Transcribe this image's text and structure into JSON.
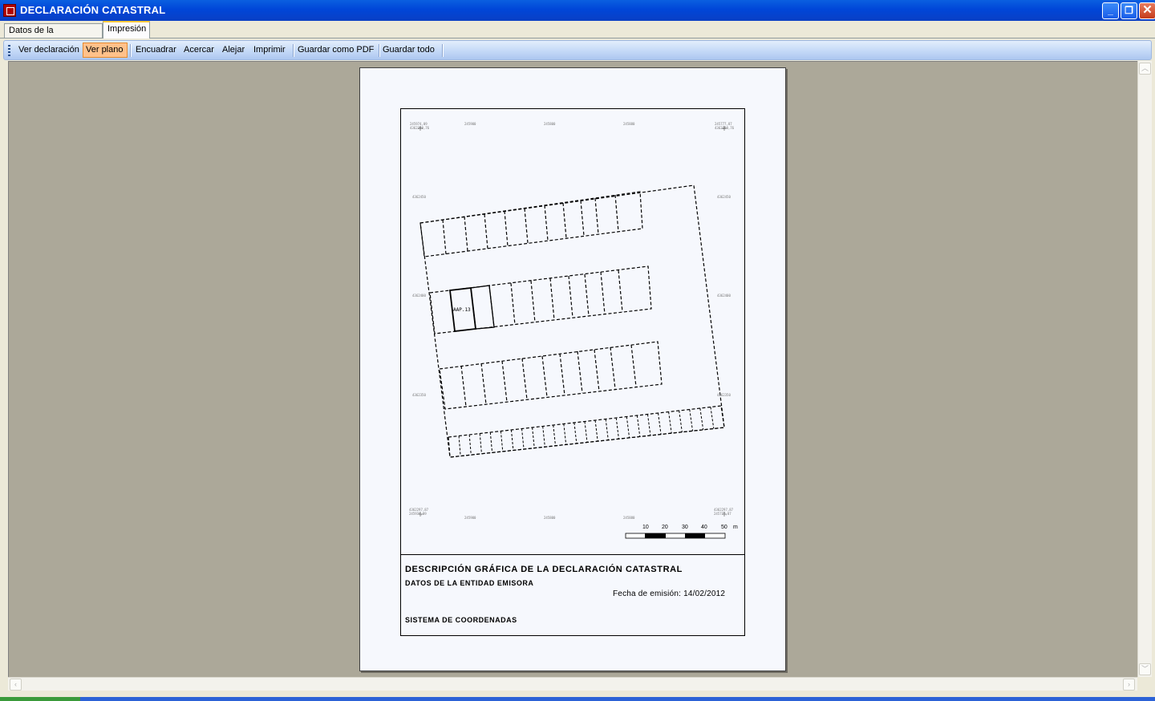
{
  "window": {
    "title": "DECLARACIÓN CATASTRAL",
    "buttons": {
      "minimize": "_",
      "restore": "❐",
      "close": "✕"
    }
  },
  "tabs": [
    {
      "label": "Datos de la declaracion",
      "active": false
    },
    {
      "label": "Impresión",
      "active": true
    }
  ],
  "toolbar": {
    "items": [
      {
        "label": "Ver declaración"
      },
      {
        "label": "Ver plano",
        "active": true
      },
      {
        "label": "Encuadrar"
      },
      {
        "label": "Acercar"
      },
      {
        "label": "Alejar"
      },
      {
        "label": "Imprimir"
      },
      {
        "label": "Guardar como PDF"
      },
      {
        "label": "Guardar todo"
      }
    ]
  },
  "plan": {
    "coords": {
      "top_left": "245974,09\n4362398,76",
      "top_1": "245900",
      "top_2": "245800",
      "top_3": "245880",
      "top_right": "245777,87\n4362398,76",
      "left_1": "4362450",
      "right_1": "4362450",
      "left_2": "4362400",
      "right_2": "4362400",
      "left_3": "4362350",
      "right_3": "4362350",
      "bottom_left": "4362297,87\n245974,09",
      "bottom_1": "245900",
      "bottom_2": "245800",
      "bottom_3": "245880",
      "bottom_right": "4362297,87\n245777,87"
    },
    "parcel_label": "AAP.13",
    "scale": {
      "ticks": [
        "10",
        "20",
        "30",
        "40",
        "50"
      ],
      "unit": "m"
    }
  },
  "legend": {
    "title": "DESCRIPCIÓN GRÁFICA DE LA DECLARACIÓN CATASTRAL",
    "entity": "DATOS DE LA ENTIDAD EMISORA",
    "date": "Fecha de emisión: 14/02/2012",
    "coords": "SISTEMA DE COORDENADAS"
  },
  "colors": {
    "title_bar": "#0046d8",
    "canvas_bg": "#aca899",
    "page_bg": "#f6f8fd",
    "active_button": "#ffc18a"
  },
  "icons": {
    "app": "app-icon",
    "scroll_up": "up-arrow-icon",
    "scroll_down": "down-arrow-icon",
    "scroll_left": "left-arrow-icon",
    "scroll_right": "right-arrow-icon"
  }
}
